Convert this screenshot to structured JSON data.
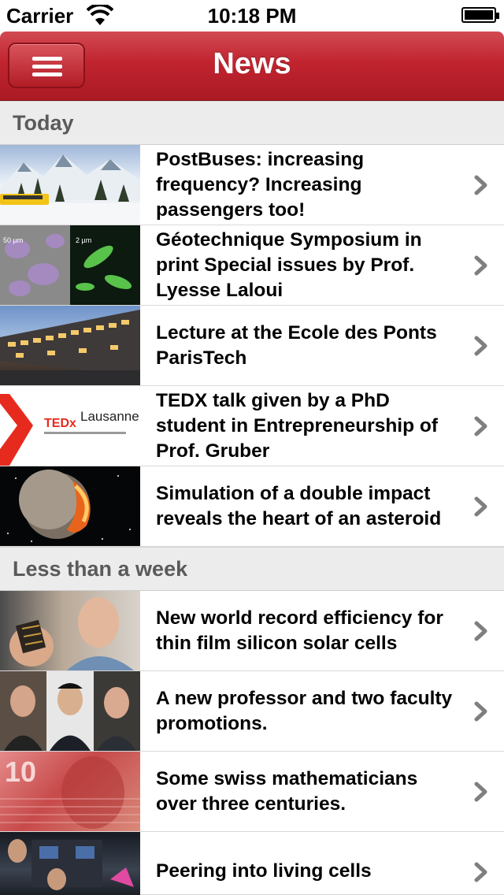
{
  "status_bar": {
    "carrier": "Carrier",
    "time": "10:18 PM"
  },
  "nav": {
    "title": "News",
    "menu_icon": "hamburger-icon"
  },
  "colors": {
    "nav_red": "#c0242f",
    "section_bg": "#ececec",
    "section_text": "#5a5a5a",
    "chevron": "#7f7f7f"
  },
  "sections": [
    {
      "title": "Today",
      "items": [
        {
          "title": "PostBuses: increasing frequency? Increasing passengers too!",
          "thumb": "snowy-mountain-bus"
        },
        {
          "title": "Géotechnique Symposium in print Special issues by Prof. Lyesse Laloui",
          "thumb": "microscopy-bacteria"
        },
        {
          "title": "Lecture at the Ecole des Ponts ParisTech",
          "thumb": "building-dusk"
        },
        {
          "title": "TEDX talk given by a PhD student in Entrepreneurship of Prof. Gruber",
          "thumb": "tedx-lausanne-logo",
          "thumb_text": "Lausanne",
          "thumb_brand": "TEDx"
        },
        {
          "title": "Simulation of a double impact reveals the heart of an asteroid",
          "thumb": "asteroid-impact"
        }
      ]
    },
    {
      "title": "Less than a week",
      "items": [
        {
          "title": "New world record efficiency for thin film silicon solar cells",
          "thumb": "man-holding-solar-cell"
        },
        {
          "title": "A new professor and two faculty promotions.",
          "thumb": "three-portraits"
        },
        {
          "title": "Some swiss mathematicians over three centuries.",
          "thumb": "swiss-banknote"
        },
        {
          "title": "Peering into living cells",
          "thumb": "lab-microscope"
        }
      ]
    }
  ]
}
